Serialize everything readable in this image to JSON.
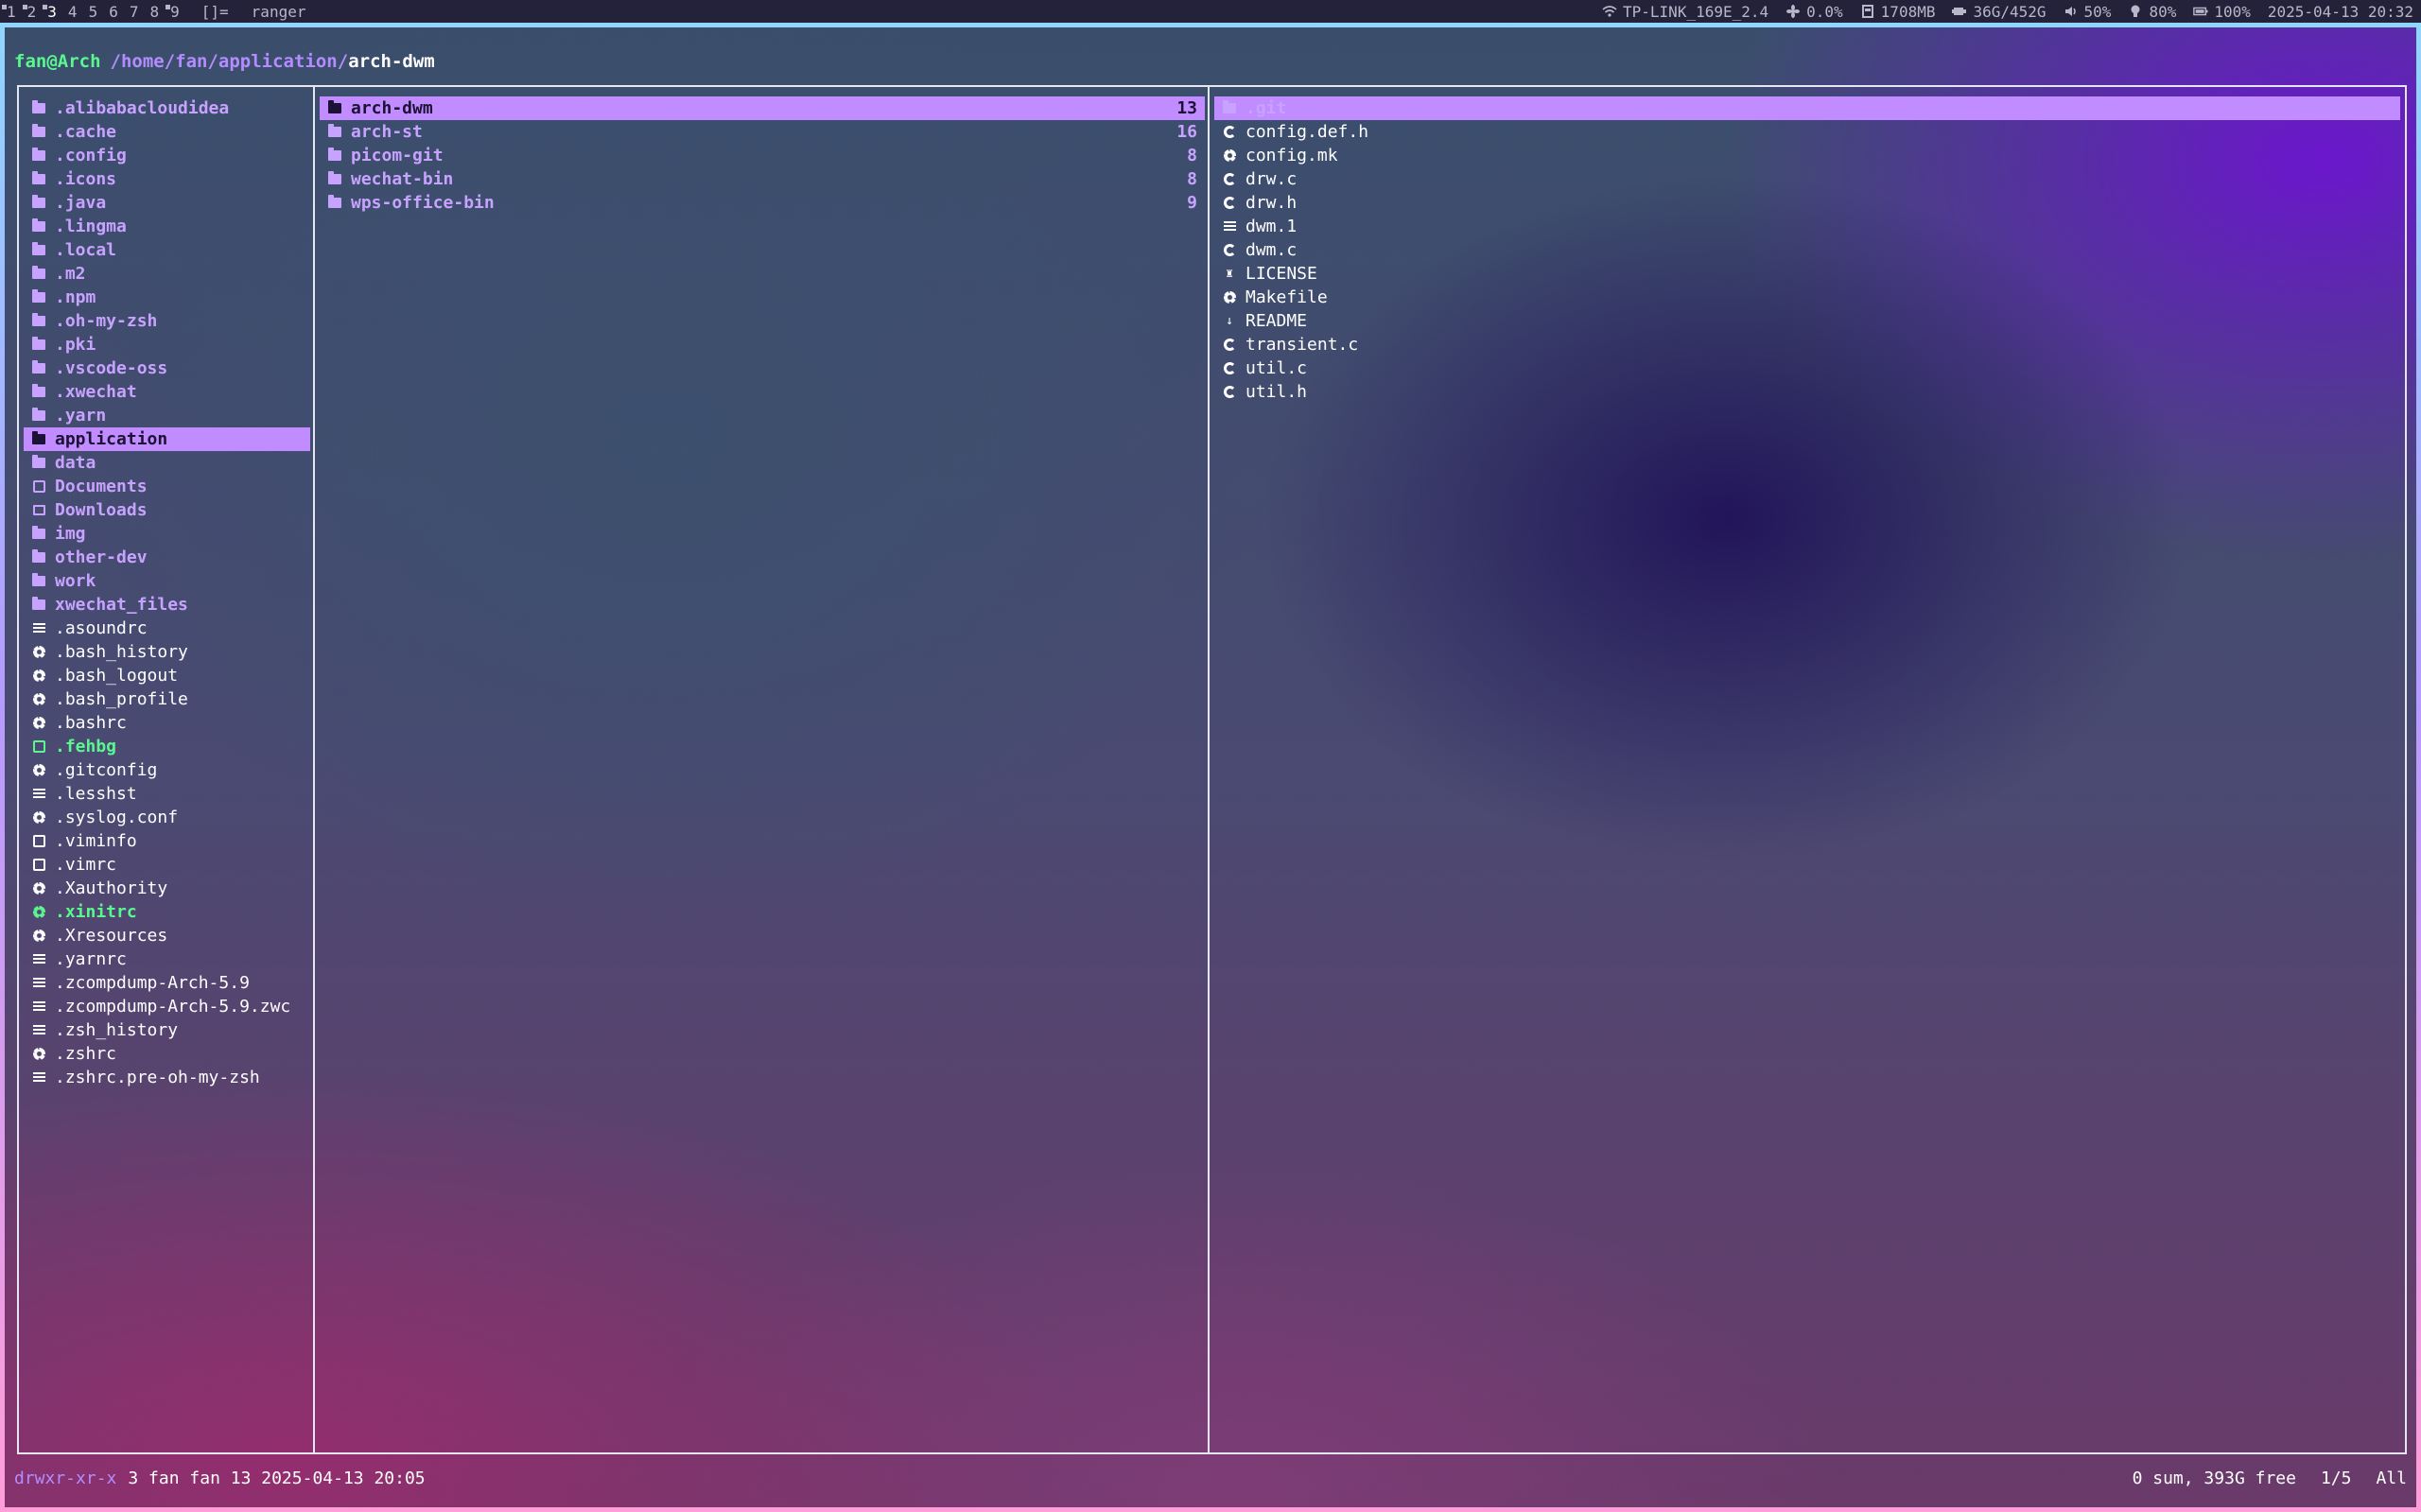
{
  "topbar": {
    "tags": [
      {
        "label": "1",
        "active": false,
        "occupied": true
      },
      {
        "label": "2",
        "active": false,
        "occupied": true
      },
      {
        "label": "3",
        "active": true,
        "occupied": true
      },
      {
        "label": "4",
        "active": false,
        "occupied": false
      },
      {
        "label": "5",
        "active": false,
        "occupied": false
      },
      {
        "label": "6",
        "active": false,
        "occupied": false
      },
      {
        "label": "7",
        "active": false,
        "occupied": false
      },
      {
        "label": "8",
        "active": false,
        "occupied": false
      },
      {
        "label": "9",
        "active": false,
        "occupied": true
      }
    ],
    "layout": "[]=",
    "window_title": "ranger",
    "status": {
      "wifi": "TP-LINK_169E_2.4",
      "cpu": "0.0%",
      "mem": "1708MB",
      "disk": "36G/452G",
      "volume": "50%",
      "brightness": "80%",
      "battery": "100%",
      "datetime": "2025-04-13 20:32"
    }
  },
  "terminal": {
    "user": "fan@Arch",
    "path_prefix": "/home/fan/application/",
    "current_dir": "arch-dwm"
  },
  "parent_panel": {
    "items": [
      {
        "name": ".alibabacloudidea",
        "kind": "dir"
      },
      {
        "name": ".cache",
        "kind": "dir"
      },
      {
        "name": ".config",
        "kind": "dir"
      },
      {
        "name": ".icons",
        "kind": "dir"
      },
      {
        "name": ".java",
        "kind": "dir"
      },
      {
        "name": ".lingma",
        "kind": "dir"
      },
      {
        "name": ".local",
        "kind": "dir"
      },
      {
        "name": ".m2",
        "kind": "dir"
      },
      {
        "name": ".npm",
        "kind": "dir"
      },
      {
        "name": ".oh-my-zsh",
        "kind": "dir"
      },
      {
        "name": ".pki",
        "kind": "dir"
      },
      {
        "name": ".vscode-oss",
        "kind": "dir"
      },
      {
        "name": ".xwechat",
        "kind": "dir"
      },
      {
        "name": ".yarn",
        "kind": "dir"
      },
      {
        "name": "application",
        "kind": "dir",
        "selected": true
      },
      {
        "name": "data",
        "kind": "dir"
      },
      {
        "name": "Documents",
        "kind": "dir",
        "icon": "document-icon"
      },
      {
        "name": "Downloads",
        "kind": "dir",
        "icon": "downloads-icon"
      },
      {
        "name": "img",
        "kind": "dir"
      },
      {
        "name": "other-dev",
        "kind": "dir"
      },
      {
        "name": "work",
        "kind": "dir"
      },
      {
        "name": "xwechat_files",
        "kind": "dir"
      },
      {
        "name": ".asoundrc",
        "kind": "file",
        "icon": "text-icon"
      },
      {
        "name": ".bash_history",
        "kind": "file",
        "icon": "gear-icon"
      },
      {
        "name": ".bash_logout",
        "kind": "file",
        "icon": "gear-icon"
      },
      {
        "name": ".bash_profile",
        "kind": "file",
        "icon": "gear-icon"
      },
      {
        "name": ".bashrc",
        "kind": "file",
        "icon": "gear-icon"
      },
      {
        "name": ".fehbg",
        "kind": "exec",
        "icon": "terminal-icon"
      },
      {
        "name": ".gitconfig",
        "kind": "file",
        "icon": "gear-icon"
      },
      {
        "name": ".lesshst",
        "kind": "file",
        "icon": "text-icon"
      },
      {
        "name": ".syslog.conf",
        "kind": "file",
        "icon": "gear-icon"
      },
      {
        "name": ".viminfo",
        "kind": "file",
        "icon": "vim-icon"
      },
      {
        "name": ".vimrc",
        "kind": "file",
        "icon": "vim-icon"
      },
      {
        "name": ".Xauthority",
        "kind": "file",
        "icon": "gear-icon"
      },
      {
        "name": ".xinitrc",
        "kind": "exec",
        "icon": "gear-icon"
      },
      {
        "name": ".Xresources",
        "kind": "file",
        "icon": "gear-icon"
      },
      {
        "name": ".yarnrc",
        "kind": "file",
        "icon": "text-icon"
      },
      {
        "name": ".zcompdump-Arch-5.9",
        "kind": "file",
        "icon": "text-icon"
      },
      {
        "name": ".zcompdump-Arch-5.9.zwc",
        "kind": "file",
        "icon": "text-icon"
      },
      {
        "name": ".zsh_history",
        "kind": "file",
        "icon": "text-icon"
      },
      {
        "name": ".zshrc",
        "kind": "file",
        "icon": "gear-icon"
      },
      {
        "name": ".zshrc.pre-oh-my-zsh",
        "kind": "file",
        "icon": "text-icon"
      }
    ]
  },
  "current_panel": {
    "items": [
      {
        "name": "arch-dwm",
        "count": "13",
        "selected": true
      },
      {
        "name": "arch-st",
        "count": "16"
      },
      {
        "name": "picom-git",
        "count": "8"
      },
      {
        "name": "wechat-bin",
        "count": "8"
      },
      {
        "name": "wps-office-bin",
        "count": "9"
      }
    ]
  },
  "preview_panel": {
    "items": [
      {
        "name": ".git",
        "kind": "dir",
        "icon": "git-folder-icon",
        "selected": true
      },
      {
        "name": "config.def.h",
        "kind": "file",
        "icon": "c-icon"
      },
      {
        "name": "config.mk",
        "kind": "file",
        "icon": "make-icon"
      },
      {
        "name": "drw.c",
        "kind": "file",
        "icon": "c-icon"
      },
      {
        "name": "drw.h",
        "kind": "file",
        "icon": "c-icon"
      },
      {
        "name": "dwm.1",
        "kind": "file",
        "icon": "text-icon"
      },
      {
        "name": "dwm.c",
        "kind": "file",
        "icon": "c-icon"
      },
      {
        "name": "LICENSE",
        "kind": "file",
        "icon": "license-icon"
      },
      {
        "name": "Makefile",
        "kind": "file",
        "icon": "gear-icon"
      },
      {
        "name": "README",
        "kind": "file",
        "icon": "readme-icon"
      },
      {
        "name": "transient.c",
        "kind": "file",
        "icon": "c-icon"
      },
      {
        "name": "util.c",
        "kind": "file",
        "icon": "c-icon"
      },
      {
        "name": "util.h",
        "kind": "file",
        "icon": "c-icon"
      }
    ]
  },
  "bottom": {
    "permissions": "drwxr-xr-x",
    "info": "3 fan fan 13 2025-04-13 20:05",
    "free": "0 sum, 393G free",
    "position": "1/5",
    "scroll": "All"
  }
}
